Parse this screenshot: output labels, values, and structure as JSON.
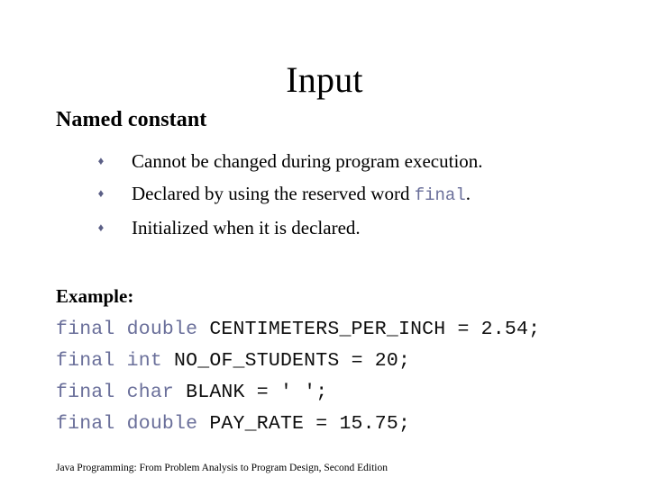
{
  "slide": {
    "title": "Input",
    "section_heading": "Named constant",
    "bullet_marker_glyph": "♦",
    "bullets": [
      {
        "text_before": "Cannot be changed during program execution.",
        "keyword": "",
        "text_after": ""
      },
      {
        "text_before": "Declared by using the reserved word ",
        "keyword": "final",
        "text_after": "."
      },
      {
        "text_before": "Initialized when it is declared.",
        "keyword": "",
        "text_after": ""
      }
    ],
    "example_label": "Example:",
    "code_lines": [
      {
        "keyword": "final double ",
        "rest": "CENTIMETERS_PER_INCH = 2.54;"
      },
      {
        "keyword": "final int ",
        "rest": "NO_OF_STUDENTS = 20;"
      },
      {
        "keyword": "final char ",
        "rest": "BLANK = ' ';"
      },
      {
        "keyword": "final double ",
        "rest": "PAY_RATE = 15.75;"
      }
    ],
    "footer": "Java Programming: From Problem Analysis to Program Design, Second Edition",
    "colors": {
      "background": "#ffffff",
      "text": "#000000",
      "keyword": "#6a6f9a",
      "bullet_marker": "#5b5f86"
    }
  }
}
